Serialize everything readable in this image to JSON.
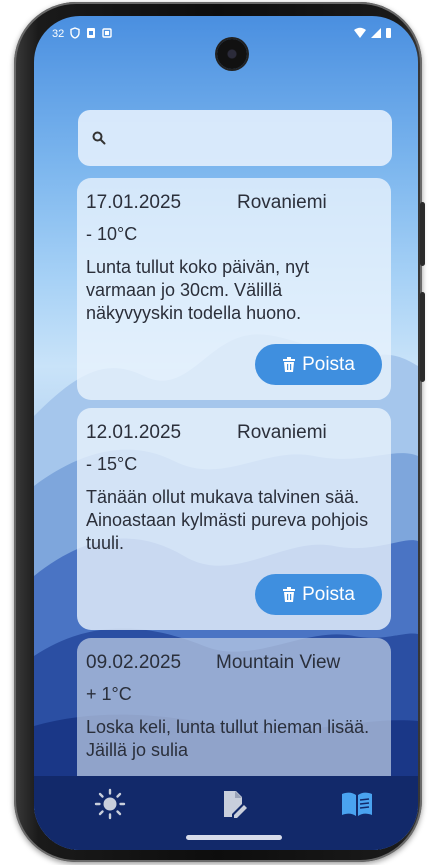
{
  "status": {
    "time": "32"
  },
  "search": {
    "placeholder": ""
  },
  "entries": [
    {
      "date": "17.01.2025",
      "location": "Rovaniemi",
      "temperature": "- 10°C",
      "text": "Lunta tullut koko päivän, nyt varmaan jo 30cm. Välillä näkyvyyskin todella huono.",
      "delete_label": "Poista"
    },
    {
      "date": "12.01.2025",
      "location": "Rovaniemi",
      "temperature": "- 15°C",
      "text": "Tänään ollut mukava talvinen sää. Ainoastaan kylmästi pureva pohjois tuuli.",
      "delete_label": "Poista"
    },
    {
      "date": "09.02.2025",
      "location": "Mountain View",
      "temperature": "+ 1°C",
      "text": "Loska keli, lunta tullut hieman lisää. Jäillä jo sulia"
    }
  ],
  "nav": {
    "items": [
      {
        "icon": "sun-icon",
        "active": false
      },
      {
        "icon": "edit-note-icon",
        "active": false
      },
      {
        "icon": "book-icon",
        "active": true
      }
    ],
    "active_color": "#4aa3f0",
    "inactive_color": "#c9cfdc"
  },
  "colors": {
    "accent": "#3f8fdf",
    "nav_background": "#12296a"
  }
}
